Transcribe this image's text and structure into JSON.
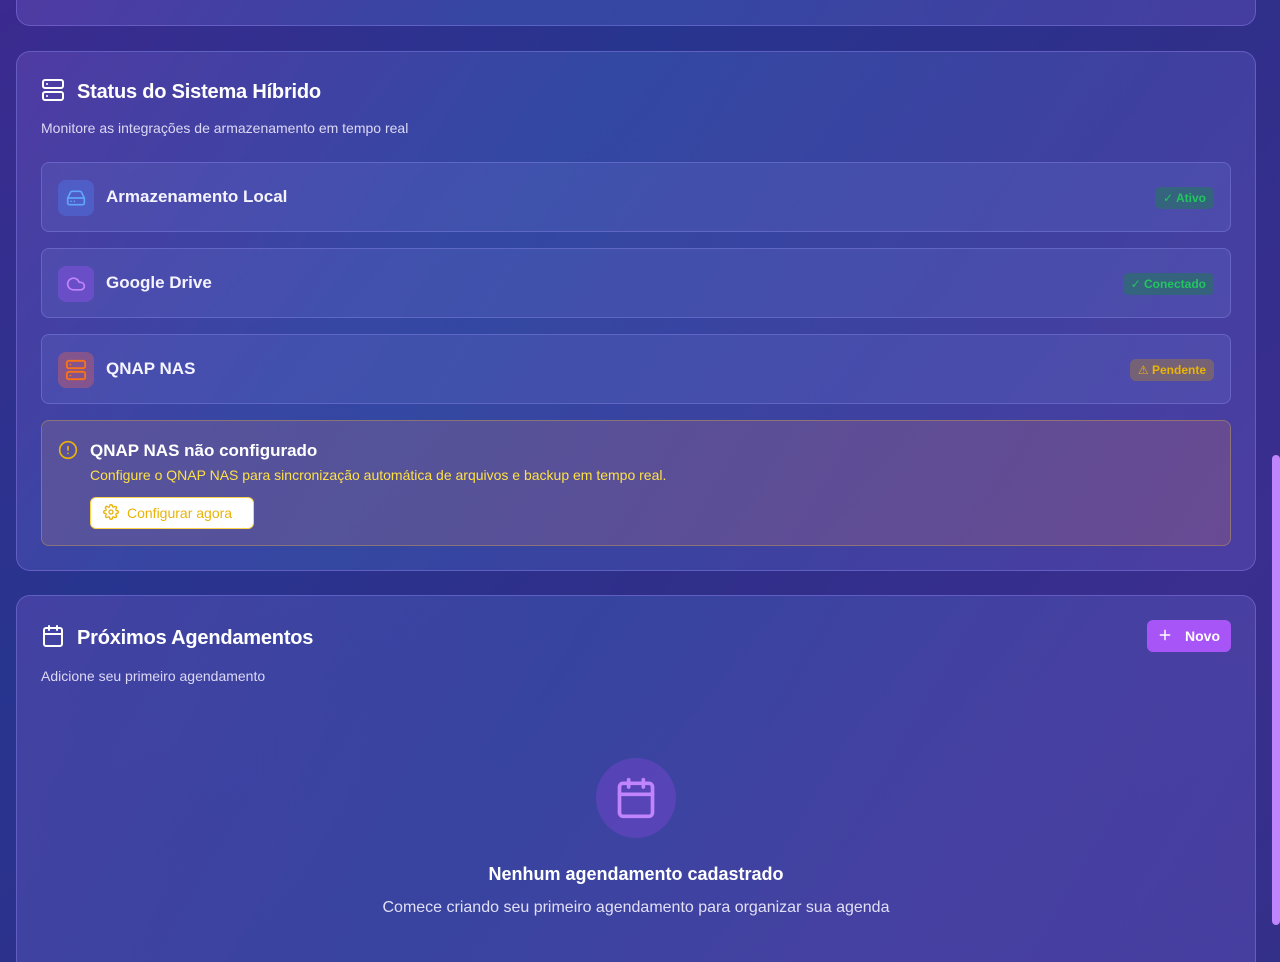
{
  "status_card": {
    "title": "Status do Sistema Híbrido",
    "subtitle": "Monitore as integrações de armazenamento em tempo real",
    "icon": "server-icon",
    "integrations": [
      {
        "name": "Armazenamento Local",
        "icon": "hard-drive-icon",
        "status": "✓ Ativo",
        "status_color": "#22c55e"
      },
      {
        "name": "Google Drive",
        "icon": "cloud-icon",
        "status": "✓ Conectado",
        "status_color": "#22c55e"
      },
      {
        "name": "QNAP NAS",
        "icon": "server-icon",
        "status": "⚠ Pendente",
        "status_color": "#eab308"
      }
    ],
    "alert": {
      "icon": "alert-circle-icon",
      "title": "QNAP NAS não configurado",
      "text": "Configure o QNAP NAS para sincronização automática de arquivos e backup em tempo real.",
      "button_label": "Configurar agora",
      "button_icon": "gear-icon"
    }
  },
  "agenda_card": {
    "title": "Próximos Agendamentos",
    "subtitle": "Adicione seu primeiro agendamento",
    "icon": "calendar-icon",
    "new_button": "Novo",
    "empty_title": "Nenhum agendamento cadastrado",
    "empty_text": "Comece criando seu primeiro agendamento para organizar sua agenda"
  },
  "colors": {
    "accent": "#a855f7",
    "success": "#22c55e",
    "warning": "#eab308"
  }
}
